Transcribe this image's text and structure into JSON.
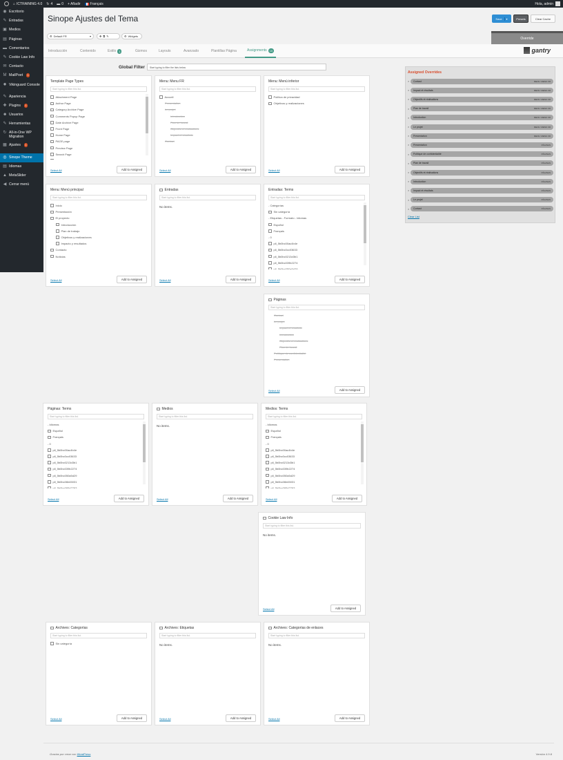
{
  "adminbar": {
    "site_name": "ICTRAINING 4.0",
    "updates": "4",
    "comments": "0",
    "new_label": "+ Añadir",
    "language": "Français",
    "greeting": "Hola, admin"
  },
  "sidebar": {
    "items": [
      {
        "label": "Escritorio",
        "icon": "◉"
      },
      {
        "label": "Entradas",
        "icon": "✎"
      },
      {
        "label": "Medios",
        "icon": "▣"
      },
      {
        "label": "Páginas",
        "icon": "▤"
      },
      {
        "label": "Comentarios",
        "icon": "▬"
      },
      {
        "label": "Cookie Law Info",
        "icon": "✎"
      },
      {
        "label": "Contacto",
        "icon": "✉"
      },
      {
        "label": "MailPoet",
        "icon": "M",
        "badge": "1"
      },
      {
        "label": "Vikinguard Console",
        "icon": "✹"
      },
      {
        "label": "Apariencia",
        "icon": "✎"
      },
      {
        "label": "Plugins",
        "icon": "✚",
        "badge": "1"
      },
      {
        "label": "Usuarios",
        "icon": "☻"
      },
      {
        "label": "Herramientas",
        "icon": "✎"
      },
      {
        "label": "All-in-One WP Migration",
        "icon": "↻"
      },
      {
        "label": "Ajustes",
        "icon": "▦",
        "badge": "1"
      },
      {
        "label": "Sinope Theme",
        "icon": "◎"
      },
      {
        "label": "Idiomas",
        "icon": "▤"
      },
      {
        "label": "MetaSlider",
        "icon": "▲"
      },
      {
        "label": "Cerrar menú",
        "icon": "◀"
      }
    ]
  },
  "header": {
    "title": "Sinope Ajustes del Tema",
    "save_label": "Save",
    "presets_label": "Presets",
    "clear_cache_label": "Clear Cache"
  },
  "toolbar": {
    "outline": "Default FR",
    "widgets": "Widgets",
    "override": "Override"
  },
  "tabs": [
    {
      "label": "Introducción"
    },
    {
      "label": "Contenido"
    },
    {
      "label": "Estilo",
      "badge": "1"
    },
    {
      "label": "Gizmos"
    },
    {
      "label": "Layouts"
    },
    {
      "label": "Avanzado"
    },
    {
      "label": "Plantillas Página"
    },
    {
      "label": "Assignments",
      "badge": "15",
      "active": true
    }
  ],
  "logo_text": "gantry",
  "global_filter": {
    "label": "Global Filter",
    "placeholder": "Start typing to filter the lists below"
  },
  "common": {
    "filter_placeholder": "Start typing to filter this list.",
    "select_all": "Select All",
    "add_assigned": "Add to Assigned",
    "no_items": "No items."
  },
  "cards": [
    {
      "title": "Template Page Types",
      "checkbox": false,
      "items": [
        {
          "t": "Attachment Page",
          "cb": true
        },
        {
          "t": "Author Page",
          "cb": true
        },
        {
          "t": "Category Archive Page",
          "cb": true
        },
        {
          "t": "Comments Popup Page",
          "cb": true
        },
        {
          "t": "Date Archive Page",
          "cb": true
        },
        {
          "t": "Front Page",
          "cb": true
        },
        {
          "t": "Home Page",
          "cb": true
        },
        {
          "t": "PAGE page",
          "cb": true
        },
        {
          "t": "Preview Page",
          "cb": true
        },
        {
          "t": "Search Page",
          "cb": true
        },
        {
          "t": "Single Post Page",
          "cb": true
        }
      ],
      "scroll": true
    },
    {
      "title": "Menu: Menu FR",
      "checkbox": false,
      "items": [
        {
          "t": "Accueil",
          "cb": true
        },
        {
          "t": "Presentation",
          "struck": true
        },
        {
          "t": "Le projet",
          "struck": true
        },
        {
          "t": "Introduction",
          "struck": true,
          "ind": 1
        },
        {
          "t": "Plan de travail",
          "struck": true,
          "ind": 1
        },
        {
          "t": "Objectifs et réalisations",
          "struck": true,
          "ind": 1
        },
        {
          "t": "Impact et résultats",
          "struck": true,
          "ind": 1
        },
        {
          "t": "Contact",
          "struck": true
        }
      ]
    },
    {
      "title": "Menu: Menú inferior",
      "checkbox": false,
      "items": [
        {
          "t": "Política de privacidad",
          "cb": true
        },
        {
          "t": "Objetivos y realizaciones",
          "cb": true
        }
      ]
    },
    {
      "title": "Menu: Menú principal",
      "checkbox": false,
      "items": [
        {
          "t": "Inicio",
          "cb": true
        },
        {
          "t": "Presentación",
          "cb": true
        },
        {
          "t": "El proyecto",
          "cb": true
        },
        {
          "t": "Introducción",
          "cb": true,
          "ind": 1
        },
        {
          "t": "Plan de trabajo",
          "cb": true,
          "ind": 1
        },
        {
          "t": "Objetivos y realizaciones",
          "cb": true,
          "ind": 1
        },
        {
          "t": "Impacto y resultados",
          "cb": true,
          "ind": 1
        },
        {
          "t": "Contacto",
          "cb": true
        },
        {
          "t": "Noticias",
          "cb": true
        }
      ]
    },
    {
      "title": "Entradas",
      "checkbox": true,
      "noitems": true,
      "items": []
    },
    {
      "title": "Entradas: Terms",
      "checkbox": false,
      "items": [
        {
          "t": "- Categorías"
        },
        {
          "t": "Sin categoría",
          "cb": true
        },
        {
          "t": "- Etiquetas - Formato - Idiomas"
        },
        {
          "t": "Español",
          "cb": true
        },
        {
          "t": "Français",
          "cb": true
        },
        {
          "t": "- 0"
        },
        {
          "t": "pll_5b0bc00ac4b4e",
          "cb": true
        },
        {
          "t": "pll_5b0bc0cc03633",
          "cb": true
        },
        {
          "t": "pll_5b0bc0213d3b1",
          "cb": true
        },
        {
          "t": "pll_5b0bc039b2274",
          "cb": true
        },
        {
          "t": "pll_5b0bc050a5d29",
          "cb": true
        }
      ],
      "scroll": true
    },
    {
      "title": "Páginas",
      "checkbox": true,
      "items": [
        {
          "t": "Contact",
          "struck": true
        },
        {
          "t": "Le projet",
          "struck": true
        },
        {
          "t": "Impact et résultats",
          "struck": true,
          "ind": 1
        },
        {
          "t": "Introduction",
          "struck": true,
          "ind": 1
        },
        {
          "t": "Objectifs et réalisations",
          "struck": true,
          "ind": 1
        },
        {
          "t": "Plan de travail",
          "struck": true,
          "ind": 1
        },
        {
          "t": "Politique de confidentialité",
          "struck": true
        },
        {
          "t": "Presentation",
          "struck": true
        }
      ]
    },
    {
      "title": "Páginas: Terms",
      "checkbox": false,
      "items": [
        {
          "t": "- Idiomas"
        },
        {
          "t": "Español",
          "cb": true
        },
        {
          "t": "Français",
          "cb": true
        },
        {
          "t": "- 0"
        },
        {
          "t": "pll_5b0bc00ac4b4e",
          "cb": true
        },
        {
          "t": "pll_5b0bc0cc03633",
          "cb": true
        },
        {
          "t": "pll_5b0bc0213d3b1",
          "cb": true
        },
        {
          "t": "pll_5b0bc039b2274",
          "cb": true
        },
        {
          "t": "pll_5b0bc050a5d29",
          "cb": true
        },
        {
          "t": "pll_5b0bc06b45031",
          "cb": true
        },
        {
          "t": "pll_5b0bc095d2793",
          "cb": true
        }
      ],
      "scroll": true
    },
    {
      "title": "Medios",
      "checkbox": true,
      "noitems": true,
      "items": []
    },
    {
      "title": "Medios: Terms",
      "checkbox": false,
      "items": [
        {
          "t": "- Idiomas"
        },
        {
          "t": "Español",
          "cb": true
        },
        {
          "t": "Français",
          "cb": true
        },
        {
          "t": "- 0"
        },
        {
          "t": "pll_5b0bc00ac4b4e",
          "cb": true
        },
        {
          "t": "pll_5b0bc0cc03633",
          "cb": true
        },
        {
          "t": "pll_5b0bc0213d3b1",
          "cb": true
        },
        {
          "t": "pll_5b0bc039b2274",
          "cb": true
        },
        {
          "t": "pll_5b0bc050a5d29",
          "cb": true
        },
        {
          "t": "pll_5b0bc06b45031",
          "cb": true
        },
        {
          "t": "pll_5b0bc095d2793",
          "cb": true
        }
      ],
      "scroll": true
    },
    {
      "title": "Cookie Law Info",
      "checkbox": true,
      "noitems": true,
      "items": []
    },
    {
      "title": "Archives: Categorías",
      "checkbox": true,
      "items": [
        {
          "t": "Sin categoría",
          "cb": true
        }
      ]
    },
    {
      "title": "Archives: Etiquetas",
      "checkbox": true,
      "noitems": true,
      "items": []
    },
    {
      "title": "Archives: Categorías de enlaces",
      "checkbox": true,
      "noitems": true,
      "items": []
    }
  ],
  "assigned": {
    "title": "Assigned Overrides",
    "clear_list": "Clear List",
    "rows": [
      {
        "label": "Contact",
        "tag": "MENU: MENU FR"
      },
      {
        "label": "Impact et résultats",
        "tag": "MENU: MENU FR"
      },
      {
        "label": "Objectifs et réalisations",
        "tag": "MENU: MENU FR"
      },
      {
        "label": "Plan de travail",
        "tag": "MENU: MENU FR"
      },
      {
        "label": "Introduction",
        "tag": "MENU: MENU FR"
      },
      {
        "label": "Le projet",
        "tag": "MENU: MENU FR"
      },
      {
        "label": "Presentation",
        "tag": "MENU: MENU FR"
      },
      {
        "label": "Presentation",
        "tag": "PÁGINAS"
      },
      {
        "label": "Politique de confidentialité",
        "tag": "PÁGINAS"
      },
      {
        "label": "Plan de travail",
        "tag": "PÁGINAS"
      },
      {
        "label": "Objectifs et réalisations",
        "tag": "PÁGINAS"
      },
      {
        "label": "Introduction",
        "tag": "PÁGINAS"
      },
      {
        "label": "Impact et résultats",
        "tag": "PÁGINAS"
      },
      {
        "label": "Le projet",
        "tag": "PÁGINAS"
      },
      {
        "label": "Contact",
        "tag": "PÁGINAS"
      }
    ]
  },
  "footer": {
    "thanks": "Gracias por crear con",
    "wordpress": "WordPress",
    "version": "Versión 4.9.8"
  }
}
